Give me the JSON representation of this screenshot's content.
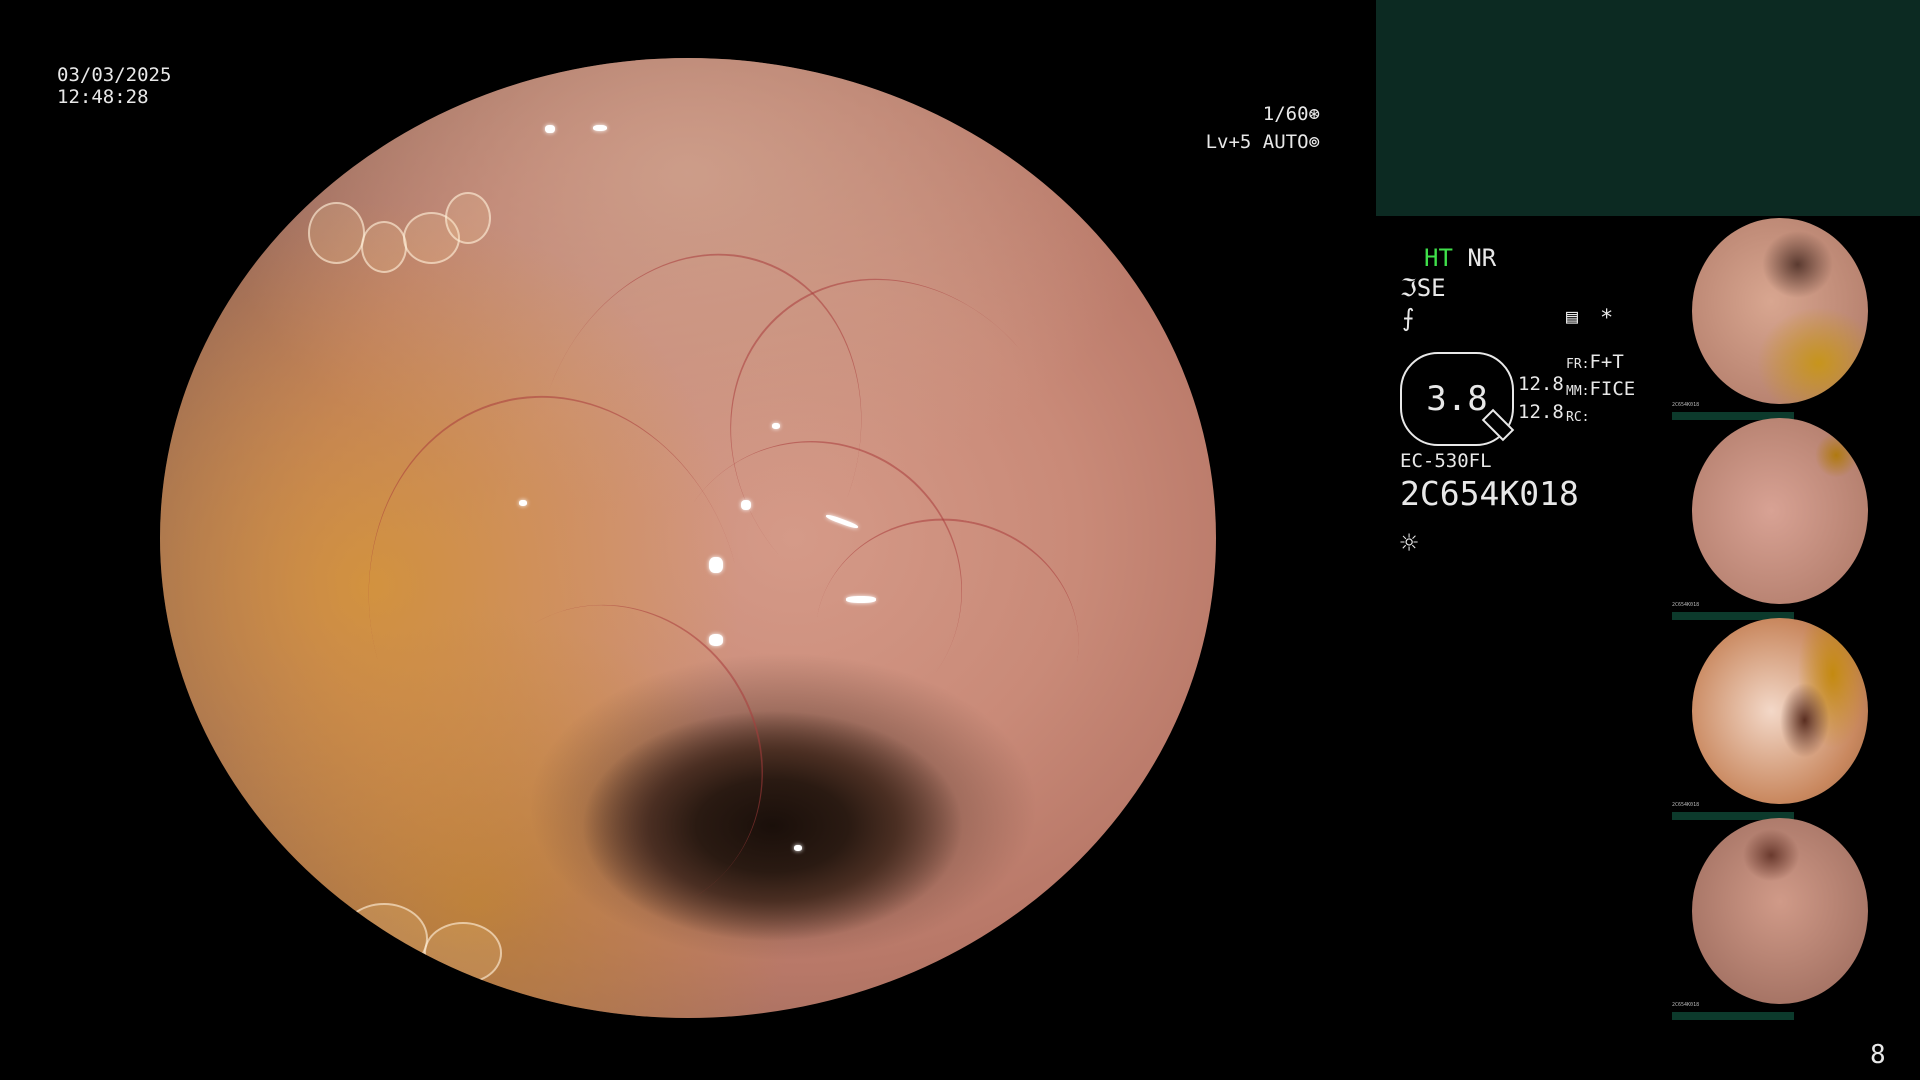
{
  "overlay": {
    "date": "03/03/2025",
    "time": "12:48:28",
    "shutter": "1/60",
    "level": "Lv+5 AUTO"
  },
  "panel": {
    "ht": "HT",
    "nr": "NR",
    "se": "SE",
    "zoom_value": "3.8",
    "value_a": "12.8",
    "value_b": "12.8",
    "fr_label": "FR:",
    "fr_value": "F+T",
    "mm_label": "MM:",
    "mm_value": "FICE",
    "rc_label": "RC:",
    "model": "EC-530FL",
    "serial": "2C654K018",
    "page_number": "8"
  },
  "thumbnails": [
    {
      "serial": "2C654K018"
    },
    {
      "serial": "2C654K018"
    },
    {
      "serial": "2C654K018"
    },
    {
      "serial": "2C654K018"
    }
  ],
  "colors": {
    "accent_green": "#3fe04a",
    "panel_dark": "#0c2a22",
    "text": "#e8e8e8"
  },
  "icons": [
    "shutter-icon",
    "auto-iris-icon",
    "scope-se-icon",
    "enhance-icon",
    "settings-icon",
    "asterisk-icon",
    "light-icon"
  ]
}
